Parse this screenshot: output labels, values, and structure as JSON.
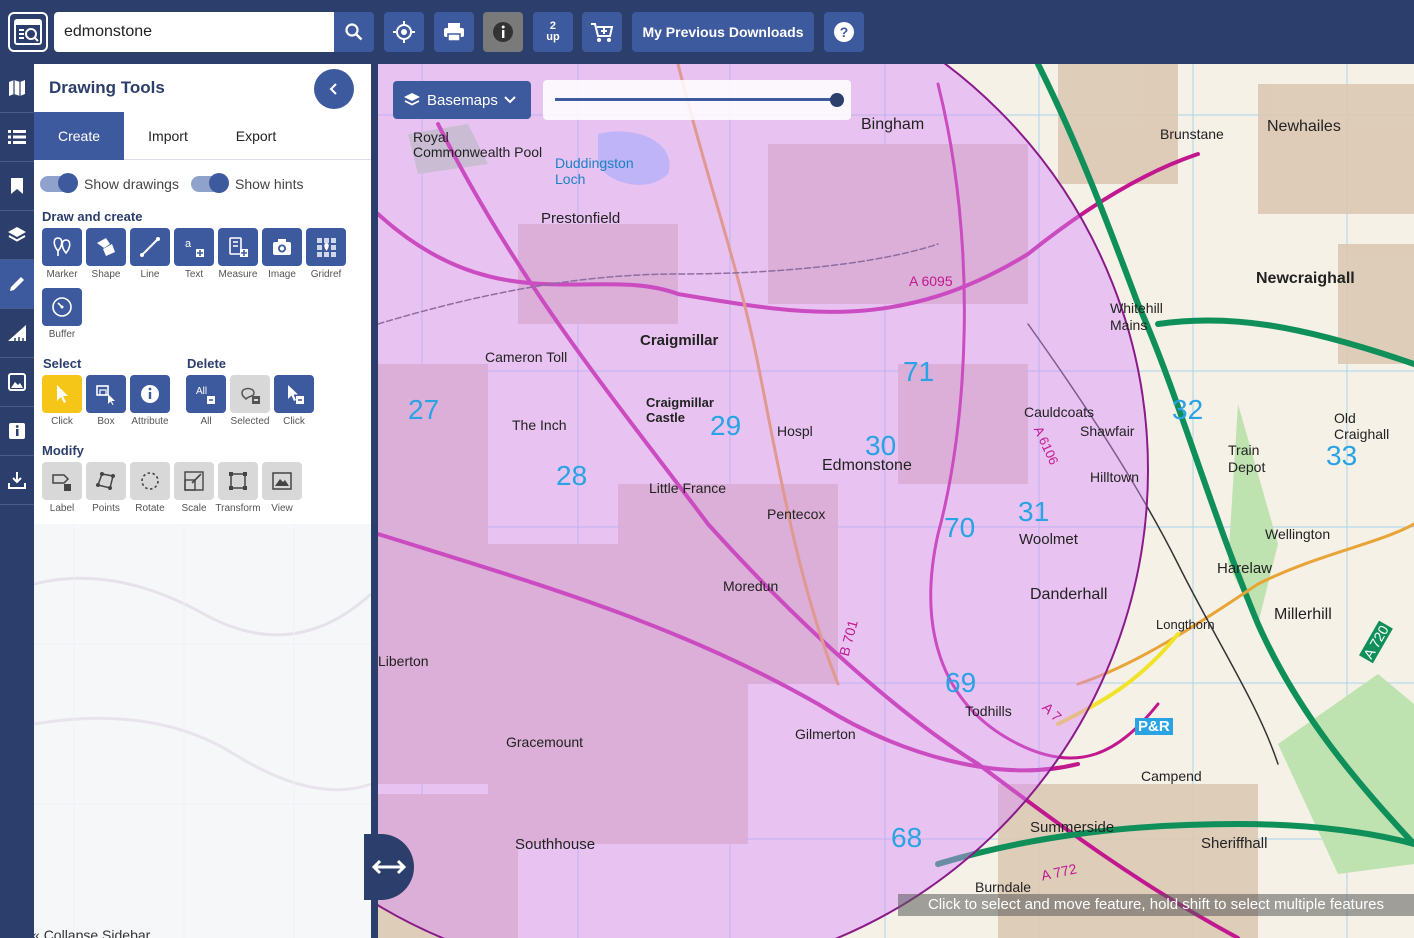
{
  "search": {
    "value": "edmonstone"
  },
  "toolbar": {
    "two_up_top": "2",
    "two_up_bottom": "up",
    "downloads_label": "My Previous Downloads"
  },
  "sidebar": {
    "title": "Drawing Tools",
    "tabs": [
      "Create",
      "Import",
      "Export"
    ],
    "active_tab": "Create",
    "toggles": {
      "show_drawings": "Show drawings",
      "show_hints": "Show hints"
    },
    "sections": {
      "draw_create": "Draw and create",
      "select": "Select",
      "delete": "Delete",
      "modify": "Modify"
    },
    "draw_tools": [
      "Marker",
      "Shape",
      "Line",
      "Text",
      "Measure",
      "Image",
      "Gridref",
      "Buffer"
    ],
    "select_tools": [
      "Click",
      "Box",
      "Attribute"
    ],
    "delete_tools": [
      "All",
      "Selected",
      "Click"
    ],
    "modify_tools": [
      "Label",
      "Points",
      "Rotate",
      "Scale",
      "Transform",
      "View"
    ],
    "collapse_label": "Collapse Sidebar"
  },
  "map": {
    "basemaps_label": "Basemaps",
    "opacity_percent": 100,
    "hint": "Click to select and move feature, hold shift to select multiple features",
    "labels": [
      "Bingham",
      "Craigmillar",
      "Edmonstone",
      "Newcraighall",
      "Newhailes",
      "Brunstane",
      "Prestonfield",
      "Cameron Toll",
      "The Inch",
      "Little France",
      "Pentecox",
      "Woolmet",
      "Danderhall",
      "Moredun",
      "Gilmerton",
      "Gracemount",
      "Southhouse",
      "Todhills",
      "Shawfair",
      "Cauldcoats",
      "Hilltown",
      "Millerhill",
      "Harelaw",
      "Wellington",
      "Sheriffhall",
      "Campend",
      "Summerside",
      "Whitehill Mains",
      "Train Depot",
      "Liberton",
      "Burndale",
      "Duddingston Loch",
      "Royal Commonwealth Pool",
      "Craigmillar Castle",
      "Hospl",
      "Old Craighall",
      "Longthorn",
      "A 6095",
      "A 6106",
      "A 720",
      "A 7",
      "A 772",
      "B 701",
      "P&R"
    ],
    "grid_numbers": [
      "30",
      "31",
      "32",
      "33",
      "27",
      "28",
      "29",
      "69",
      "68",
      "70",
      "71"
    ]
  }
}
